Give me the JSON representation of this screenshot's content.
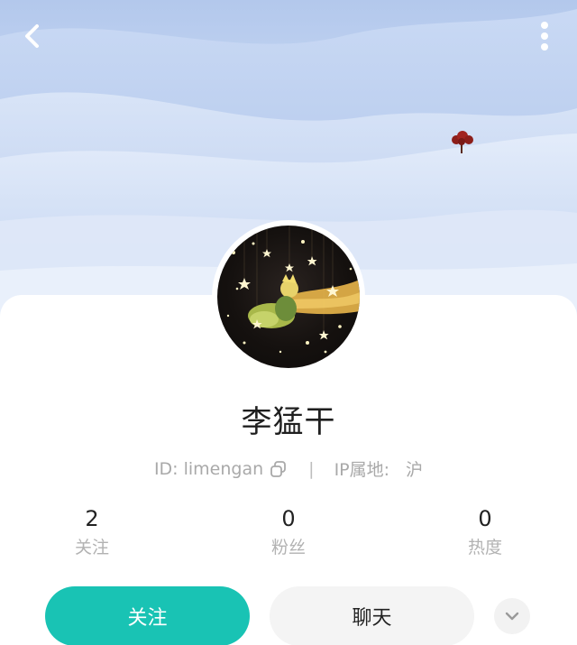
{
  "nav": {
    "back_icon": "chevron-left-icon",
    "more_icon": "vertical-dots-icon"
  },
  "profile": {
    "name": "李猛干",
    "id_label": "ID: limengan",
    "divider": "|",
    "ip_label": "IP属地:",
    "ip_value": "沪"
  },
  "stats": [
    {
      "value": "2",
      "label": "关注"
    },
    {
      "value": "0",
      "label": "粉丝"
    },
    {
      "value": "0",
      "label": "热度"
    }
  ],
  "actions": {
    "follow_label": "关注",
    "chat_label": "聊天",
    "expand_icon": "chevron-down-icon"
  },
  "colors": {
    "accent": "#19c3b4",
    "sky": "#b3c8ec",
    "muted_text": "#a9a9a9"
  }
}
